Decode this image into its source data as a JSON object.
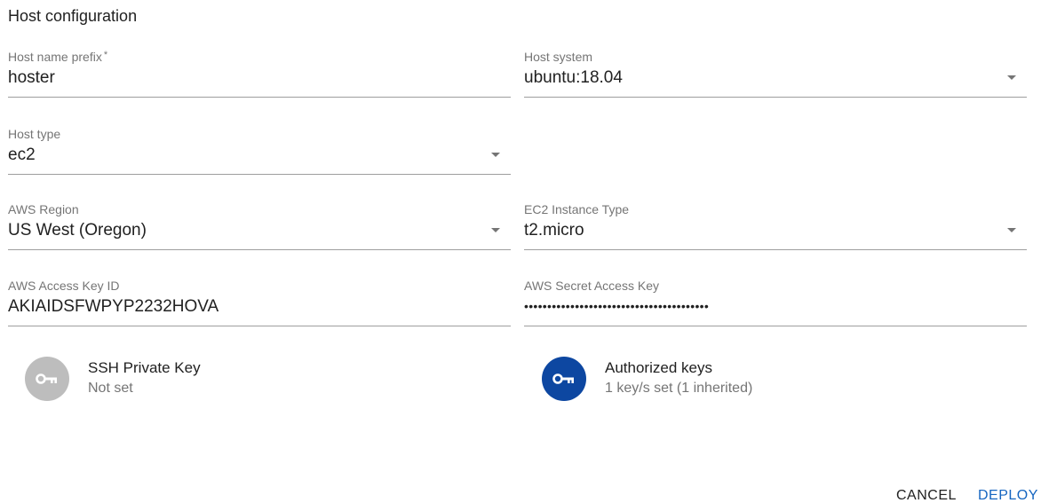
{
  "page": {
    "title": "Host configuration"
  },
  "fields": {
    "host_name_prefix": {
      "label": "Host name prefix",
      "required_mark": "*",
      "value": "hoster"
    },
    "host_system": {
      "label": "Host system",
      "value": "ubuntu:18.04"
    },
    "host_type": {
      "label": "Host type",
      "value": "ec2"
    },
    "aws_region": {
      "label": "AWS Region",
      "value": "US West (Oregon)"
    },
    "ec2_instance_type": {
      "label": "EC2 Instance Type",
      "value": "t2.micro"
    },
    "aws_access_key_id": {
      "label": "AWS Access Key ID",
      "value": "AKIAIDSFWPYP2232HOVA"
    },
    "aws_secret_access_key": {
      "label": "AWS Secret Access Key",
      "value": "••••••••••••••••••••••••••••••••••••••••"
    }
  },
  "keys": {
    "ssh_private_key": {
      "title": "SSH Private Key",
      "status": "Not set",
      "icon": "key-icon",
      "color": "#bdbdbd"
    },
    "authorized_keys": {
      "title": "Authorized keys",
      "status": "1 key/s set (1 inherited)",
      "icon": "key-icon",
      "color": "#0d47a1"
    }
  },
  "actions": {
    "cancel_label": "CANCEL",
    "deploy_label": "DEPLOY"
  },
  "colors": {
    "accent": "#1565c0"
  }
}
